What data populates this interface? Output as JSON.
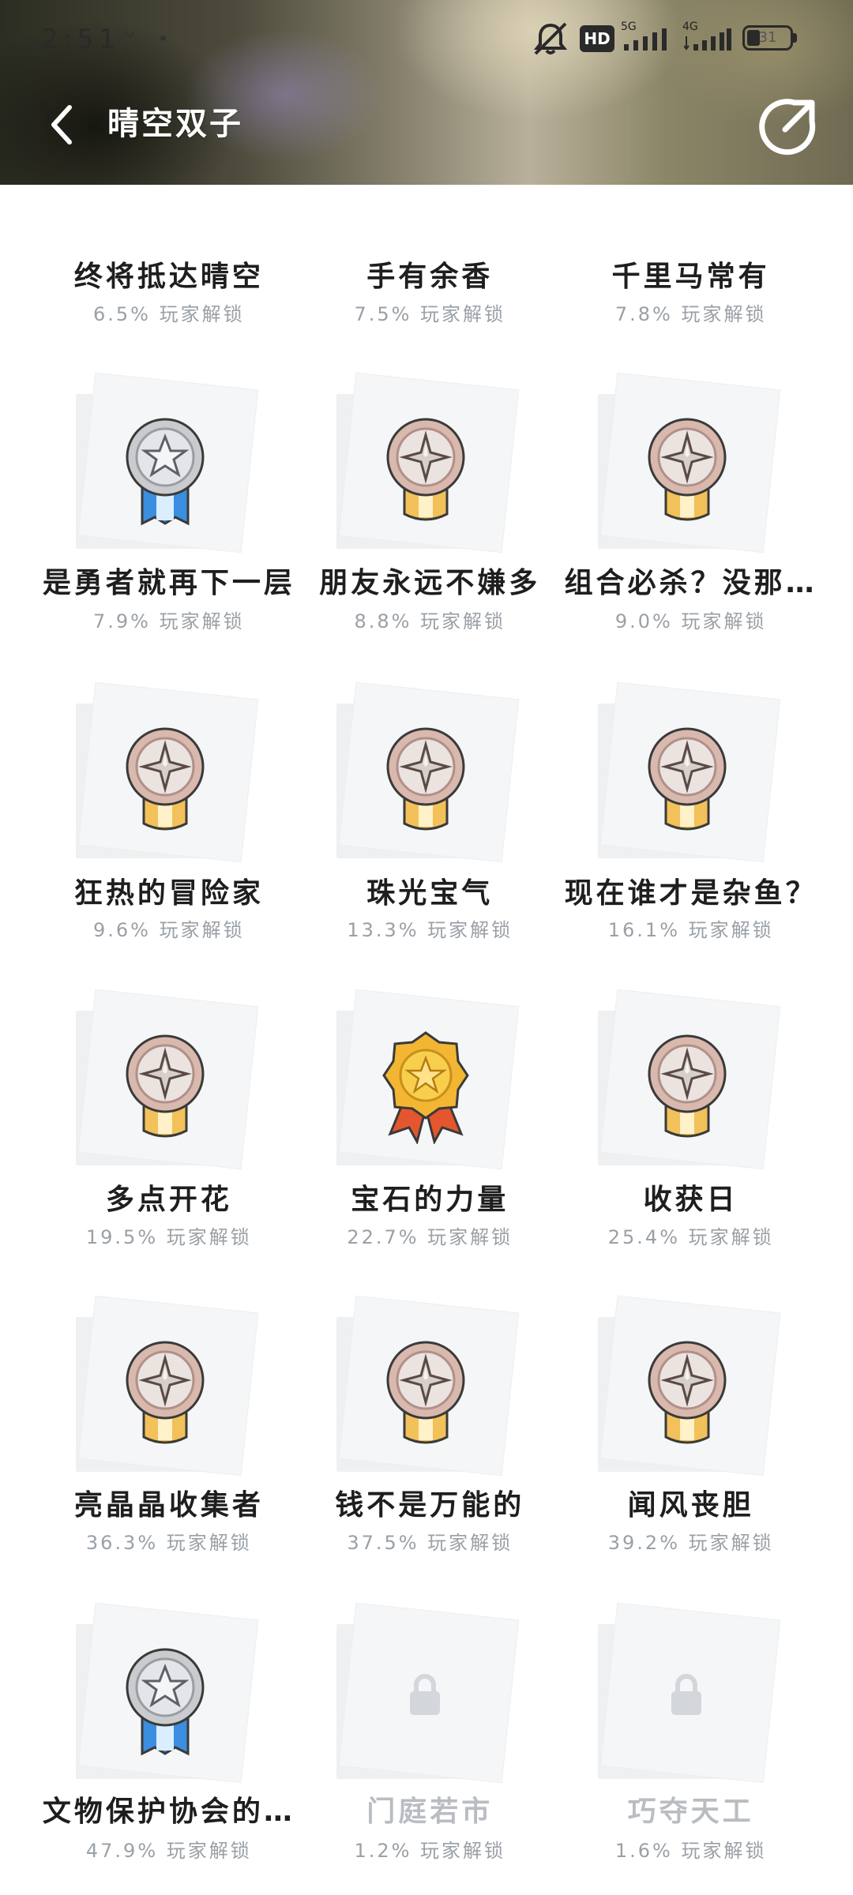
{
  "status_bar": {
    "time": "2:51",
    "hd": "HD",
    "net1": "5G",
    "net2": "4G",
    "battery": "31",
    "battery_level": 0.31
  },
  "header": {
    "title": "晴空双子",
    "back_icon": "chevron-left-icon",
    "share_icon": "share-icon"
  },
  "achievements": [
    {
      "name": "终将抵达晴空",
      "rate": "6.5% 玩家解锁",
      "medal": "gold",
      "locked": false
    },
    {
      "name": "手有余香",
      "rate": "7.5% 玩家解锁",
      "medal": "silver",
      "locked": false
    },
    {
      "name": "千里马常有",
      "rate": "7.8% 玩家解锁",
      "medal": "silver",
      "locked": false
    },
    {
      "name": "是勇者就再下一层",
      "rate": "7.9% 玩家解锁",
      "medal": "silver",
      "locked": false
    },
    {
      "name": "朋友永远不嫌多",
      "rate": "8.8% 玩家解锁",
      "medal": "bronze",
      "locked": false
    },
    {
      "name": "组合必杀？没那…",
      "rate": "9.0% 玩家解锁",
      "medal": "bronze",
      "locked": false
    },
    {
      "name": "狂热的冒险家",
      "rate": "9.6% 玩家解锁",
      "medal": "bronze",
      "locked": false
    },
    {
      "name": "珠光宝气",
      "rate": "13.3% 玩家解锁",
      "medal": "bronze",
      "locked": false
    },
    {
      "name": "现在谁才是杂鱼？",
      "rate": "16.1% 玩家解锁",
      "medal": "bronze",
      "locked": false
    },
    {
      "name": "多点开花",
      "rate": "19.5% 玩家解锁",
      "medal": "bronze",
      "locked": false
    },
    {
      "name": "宝石的力量",
      "rate": "22.7% 玩家解锁",
      "medal": "gold",
      "locked": false
    },
    {
      "name": "收获日",
      "rate": "25.4% 玩家解锁",
      "medal": "bronze",
      "locked": false
    },
    {
      "name": "亮晶晶收集者",
      "rate": "36.3% 玩家解锁",
      "medal": "bronze",
      "locked": false
    },
    {
      "name": "钱不是万能的",
      "rate": "37.5% 玩家解锁",
      "medal": "bronze",
      "locked": false
    },
    {
      "name": "闻风丧胆",
      "rate": "39.2% 玩家解锁",
      "medal": "bronze",
      "locked": false
    },
    {
      "name": "文物保护协会的…",
      "rate": "47.9% 玩家解锁",
      "medal": "silver",
      "locked": false
    },
    {
      "name": "门庭若市",
      "rate": "1.2% 玩家解锁",
      "medal": "lock",
      "locked": true
    },
    {
      "name": "巧夺天工",
      "rate": "1.6% 玩家解锁",
      "medal": "lock",
      "locked": true
    }
  ]
}
